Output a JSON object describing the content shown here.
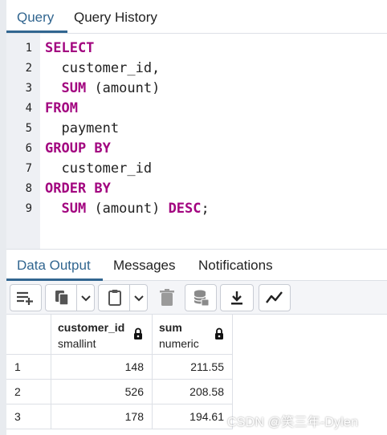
{
  "query_tabs": [
    {
      "label": "Query"
    },
    {
      "label": "Query History"
    }
  ],
  "editor": {
    "line_numbers": [
      "1",
      "2",
      "3",
      "4",
      "5",
      "6",
      "7",
      "8",
      "9"
    ]
  },
  "output_tabs": [
    {
      "label": "Data Output"
    },
    {
      "label": "Messages"
    },
    {
      "label": "Notifications"
    }
  ],
  "grid": {
    "columns": [
      {
        "name": "customer_id",
        "type": "smallint"
      },
      {
        "name": "sum",
        "type": "numeric"
      }
    ],
    "rows": [
      {
        "n": "1",
        "customer_id": "148",
        "sum": "211.55"
      },
      {
        "n": "2",
        "customer_id": "526",
        "sum": "208.58"
      },
      {
        "n": "3",
        "customer_id": "178",
        "sum": "194.61"
      }
    ]
  },
  "watermark": "CSDN @笑三年-Dylen",
  "colors": {
    "accent": "#326690",
    "keyword": "#a2047f"
  },
  "toolbar_icons": [
    "add-row-icon",
    "copy-icon",
    "chevron-down-icon",
    "paste-icon",
    "chevron-down-icon",
    "delete-icon",
    "save-data-icon",
    "download-icon",
    "graph-visualiser-icon"
  ]
}
